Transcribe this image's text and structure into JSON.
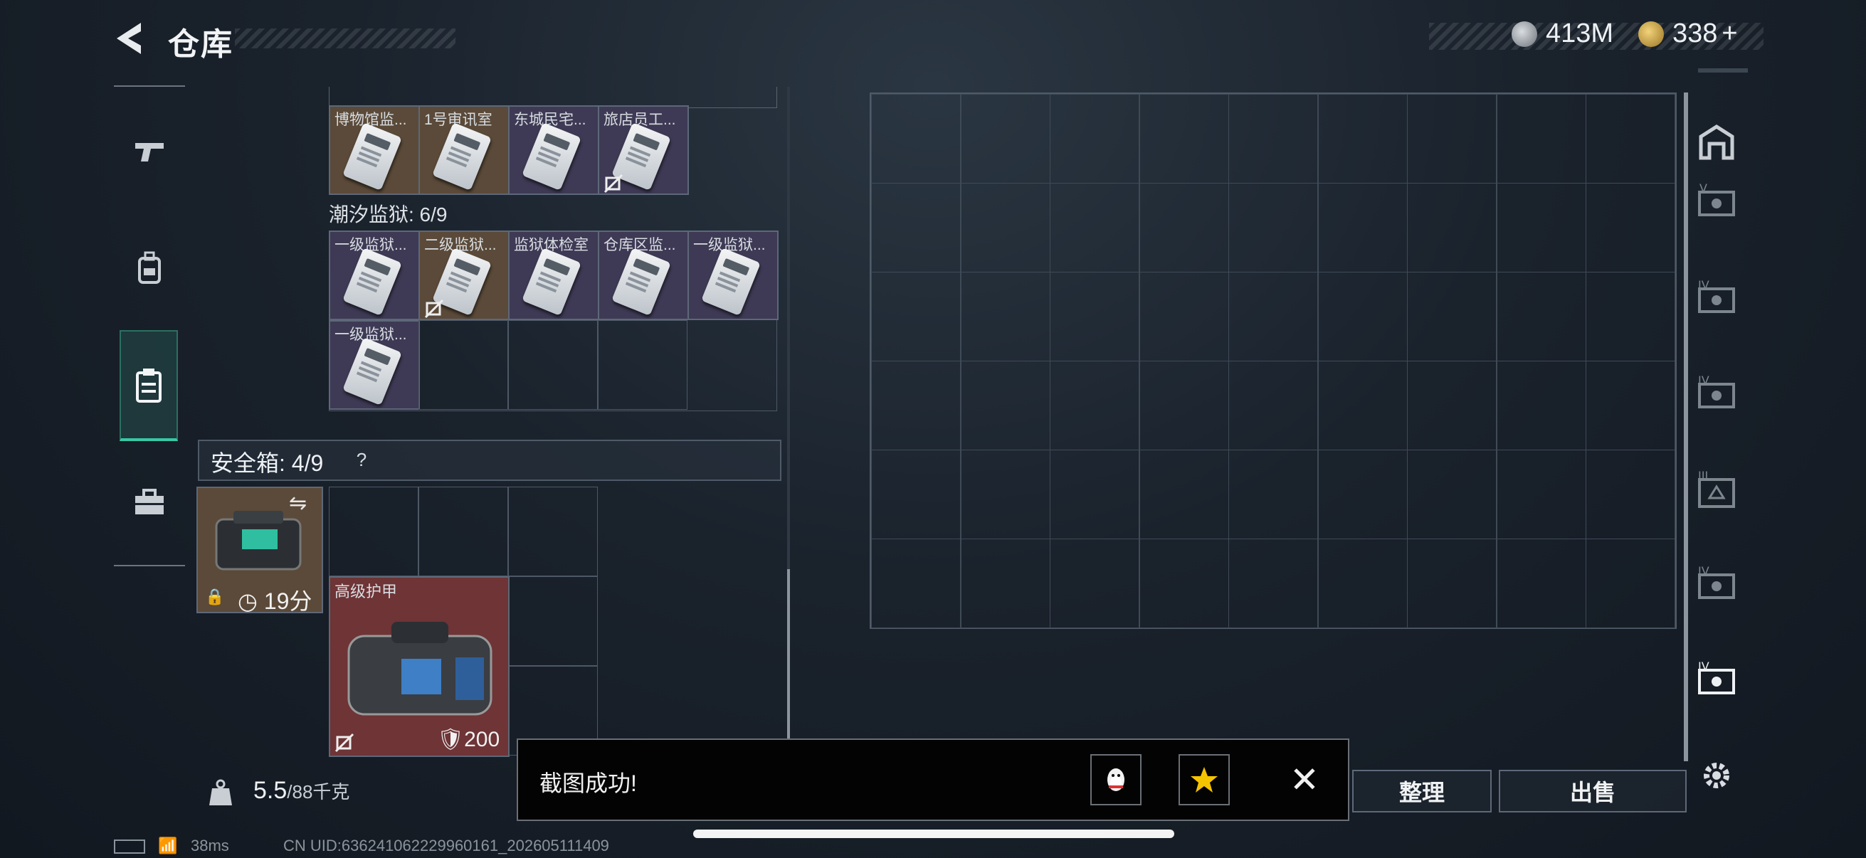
{
  "header": {
    "title": "仓库"
  },
  "currency": {
    "coins": "413M",
    "tickets": "338",
    "tickets_add": "+"
  },
  "nav": {
    "items": [
      "weapon-icon",
      "backpack-icon",
      "clipboard-icon",
      "toolbox-icon"
    ],
    "active_index": 2
  },
  "keycards_top": [
    "博物馆监...",
    "1号审讯室",
    "东城民宅...",
    "旅店员工..."
  ],
  "prison_section": {
    "label": "潮汐监狱: 6/9",
    "items": [
      "一级监狱...",
      "二级监狱...",
      "监狱体检室",
      "仓库区监...",
      "一级监狱...",
      "一级监狱..."
    ]
  },
  "safe": {
    "label": "安全箱: 4/9",
    "help": "?",
    "timer": "19分",
    "armor_label": "高级护甲",
    "armor_value": "200"
  },
  "weight": {
    "current": "5.5",
    "max": "/88千克"
  },
  "buttons": {
    "sort": "整理",
    "sell": "出售"
  },
  "toast": {
    "message": "截图成功!",
    "close": "✕"
  },
  "status": {
    "ping": "38ms",
    "uid": "CN UID:636241062229960161_202605111409"
  },
  "colors": {
    "accent": "#38c9a5",
    "gold": "#c8a548",
    "armor_bg": "#6e3436"
  }
}
